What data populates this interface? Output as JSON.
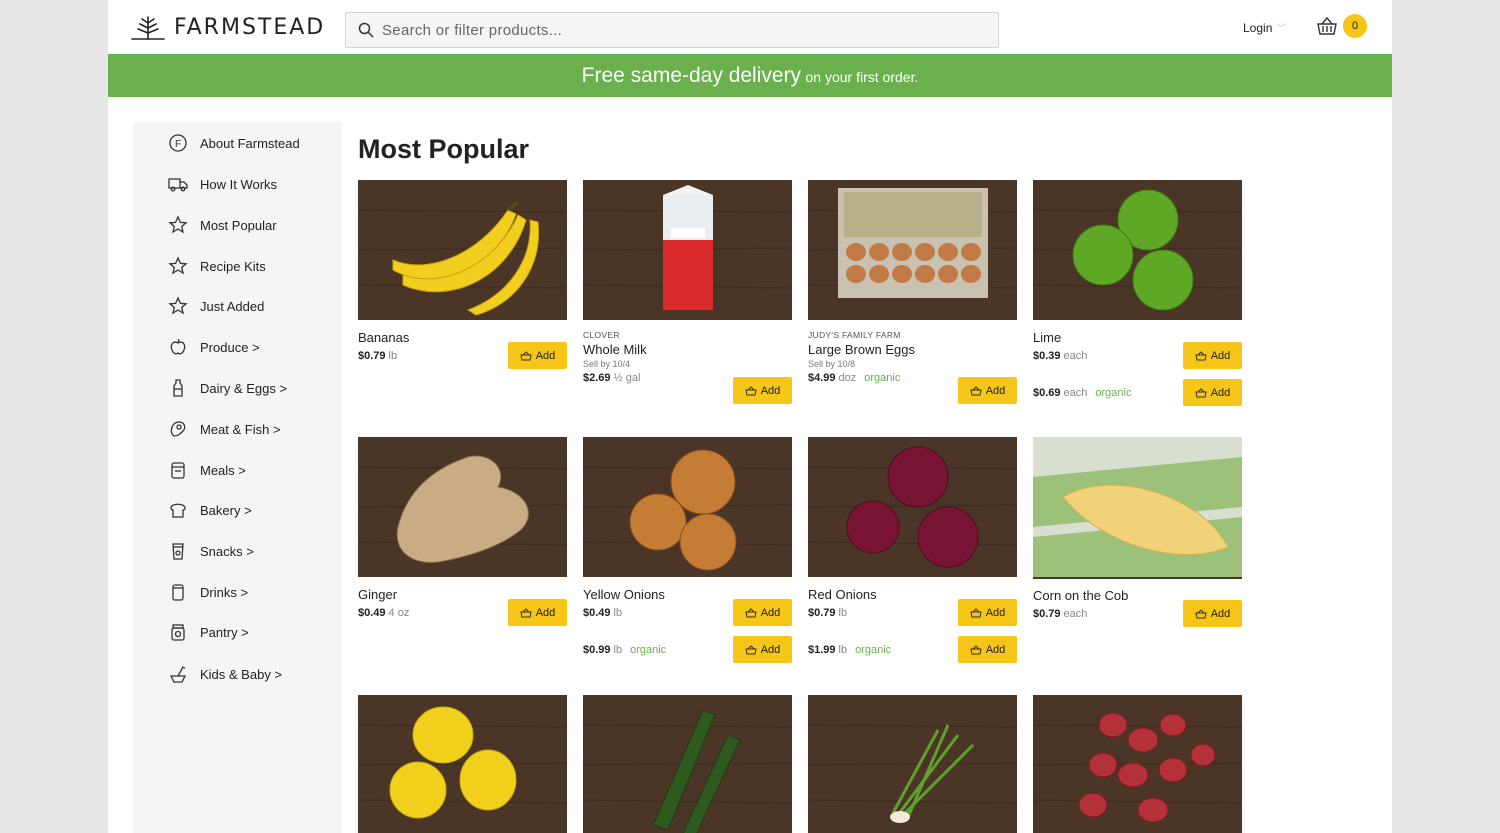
{
  "brand": {
    "name": "FARMSTEAD"
  },
  "search": {
    "placeholder": "Search or filter products..."
  },
  "header": {
    "login_label": "Login",
    "cart_count": "0"
  },
  "promo": {
    "headline": "Free same-day delivery",
    "subline": "on your first order."
  },
  "sidebar": {
    "items": [
      {
        "label": "About Farmstead",
        "icon": "farmstead-logo-icon"
      },
      {
        "label": "How It Works",
        "icon": "truck-icon"
      },
      {
        "label": "Most Popular",
        "icon": "star-icon"
      },
      {
        "label": "Recipe Kits",
        "icon": "star-icon"
      },
      {
        "label": "Just Added",
        "icon": "star-icon"
      },
      {
        "label": "Produce >",
        "icon": "apple-icon"
      },
      {
        "label": "Dairy & Eggs >",
        "icon": "milk-bottle-icon"
      },
      {
        "label": "Meat & Fish >",
        "icon": "steak-icon"
      },
      {
        "label": "Meals >",
        "icon": "container-icon"
      },
      {
        "label": "Bakery >",
        "icon": "bread-icon"
      },
      {
        "label": "Snacks >",
        "icon": "snack-bag-icon"
      },
      {
        "label": "Drinks >",
        "icon": "can-icon"
      },
      {
        "label": "Pantry >",
        "icon": "jar-icon"
      },
      {
        "label": "Kids & Baby >",
        "icon": "bottle-icon"
      }
    ]
  },
  "main": {
    "heading": "Most Popular",
    "add_label": "Add",
    "products": [
      {
        "name": "Bananas",
        "brand": "",
        "sell_by": "",
        "image": "bananas",
        "prices": [
          {
            "price": "$0.79",
            "unit": "lb",
            "organic": ""
          }
        ]
      },
      {
        "name": "Whole Milk",
        "brand": "CLOVER",
        "sell_by": "Sell by 10/4",
        "image": "milk",
        "prices": [
          {
            "price": "$2.69",
            "unit": "½ gal",
            "organic": ""
          }
        ]
      },
      {
        "name": "Large Brown Eggs",
        "brand": "JUDY'S FAMILY FARM",
        "sell_by": "Sell by 10/8",
        "image": "eggs",
        "prices": [
          {
            "price": "$4.99",
            "unit": "doz",
            "organic": "organic"
          }
        ]
      },
      {
        "name": "Lime",
        "brand": "",
        "sell_by": "",
        "image": "lime",
        "prices": [
          {
            "price": "$0.39",
            "unit": "each",
            "organic": ""
          },
          {
            "price": "$0.69",
            "unit": "each",
            "organic": "organic"
          }
        ]
      },
      {
        "name": "Ginger",
        "brand": "",
        "sell_by": "",
        "image": "ginger",
        "prices": [
          {
            "price": "$0.49",
            "unit": "4 oz",
            "organic": ""
          }
        ]
      },
      {
        "name": "Yellow Onions",
        "brand": "",
        "sell_by": "",
        "image": "yellow-onions",
        "prices": [
          {
            "price": "$0.49",
            "unit": "lb",
            "organic": ""
          },
          {
            "price": "$0.99",
            "unit": "lb",
            "organic": "organic"
          }
        ]
      },
      {
        "name": "Red Onions",
        "brand": "",
        "sell_by": "",
        "image": "red-onions",
        "prices": [
          {
            "price": "$0.79",
            "unit": "lb",
            "organic": ""
          },
          {
            "price": "$1.99",
            "unit": "lb",
            "organic": "organic"
          }
        ]
      },
      {
        "name": "Corn on the Cob",
        "brand": "",
        "sell_by": "",
        "image": "corn",
        "prices": [
          {
            "price": "$0.79",
            "unit": "each",
            "organic": ""
          }
        ]
      },
      {
        "name": "",
        "brand": "",
        "sell_by": "",
        "image": "lemons",
        "prices": []
      },
      {
        "name": "",
        "brand": "",
        "sell_by": "",
        "image": "zucchini",
        "prices": []
      },
      {
        "name": "",
        "brand": "",
        "sell_by": "",
        "image": "green-onions",
        "prices": []
      },
      {
        "name": "",
        "brand": "",
        "sell_by": "",
        "image": "red-potatoes",
        "prices": []
      }
    ]
  },
  "colors": {
    "accent_green": "#6ab04c",
    "button_yellow": "#f5c518",
    "wood": "#4a3526"
  }
}
